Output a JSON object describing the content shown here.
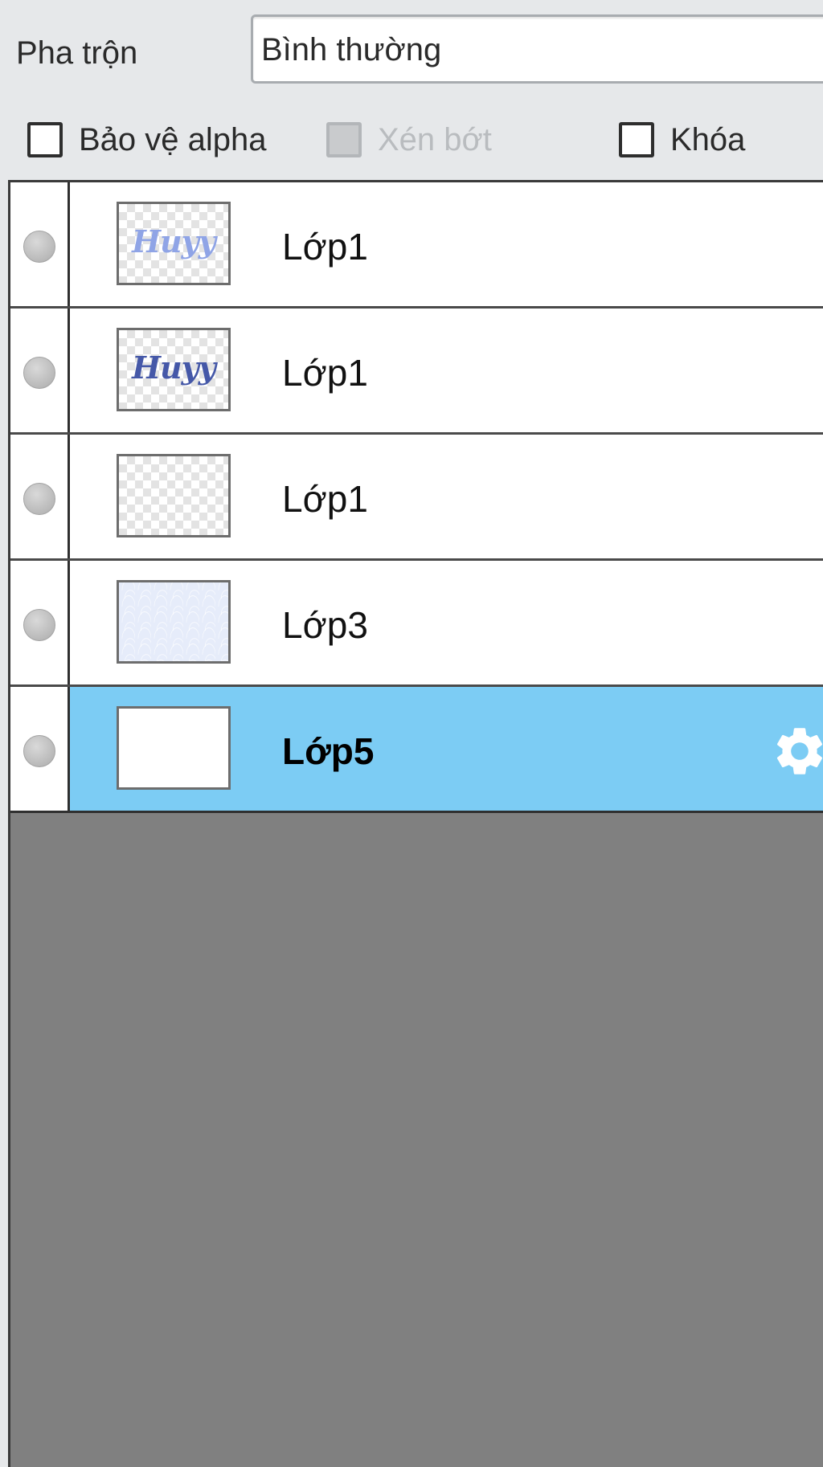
{
  "blend": {
    "label": "Pha trộn",
    "value": "Bình thường"
  },
  "options": {
    "protect_alpha": {
      "label": "Bảo vệ alpha",
      "checked": false,
      "enabled": true
    },
    "clipping": {
      "label": "Xén bớt",
      "checked": false,
      "enabled": false
    },
    "lock": {
      "label": "Khóa",
      "checked": false,
      "enabled": true
    }
  },
  "layers": [
    {
      "name": "Lớp1",
      "thumbnail_text": "Huyy",
      "selected": false
    },
    {
      "name": "Lớp1",
      "thumbnail_text": "Huyy",
      "selected": false
    },
    {
      "name": "Lớp1",
      "selected": false
    },
    {
      "name": "Lớp3",
      "selected": false
    },
    {
      "name": "Lớp5",
      "selected": true,
      "settings_icon": "gear-icon"
    }
  ],
  "colors": {
    "selected_row": "#7cccf4",
    "empty_area": "#808080",
    "panel_bg": "#e6e8ea"
  }
}
